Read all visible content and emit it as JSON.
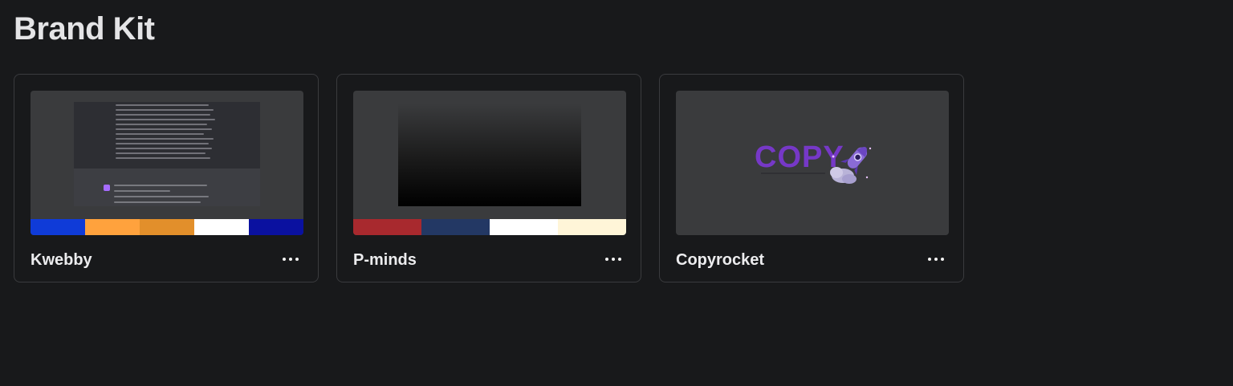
{
  "page": {
    "title": "Brand Kit"
  },
  "brand_kits": [
    {
      "name": "Kwebby",
      "palette": [
        "#0f3bd8",
        "#ffa23d",
        "#e28f2b",
        "#ffffff",
        "#0a11a0"
      ]
    },
    {
      "name": "P-minds",
      "palette": [
        "#a8292e",
        "#233864",
        "#ffffff",
        "#fff5d8"
      ]
    },
    {
      "name": "Copyrocket",
      "logo_text": "COPY",
      "palette": []
    }
  ],
  "more_icon": "more-horizontal-icon"
}
